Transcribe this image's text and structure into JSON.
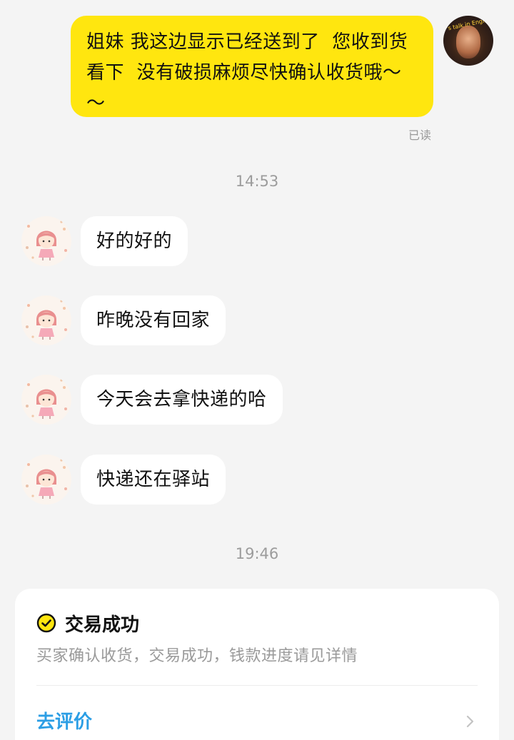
{
  "outgoing_message": {
    "text": "姐妹 我这边显示已经送到了  您收到货看下  没有破损麻烦尽快确认收货哦～～",
    "read_status": "已读",
    "avatar_caption": "'s talk in Engli"
  },
  "timestamps": {
    "first": "14:53",
    "second": "19:46"
  },
  "incoming_messages": [
    {
      "text": "好的好的"
    },
    {
      "text": "昨晚没有回家"
    },
    {
      "text": "今天会去拿快递的哈"
    },
    {
      "text": "快递还在驿站"
    }
  ],
  "order_card": {
    "status_title": "交易成功",
    "description": "买家确认收货，交易成功，钱款进度请见详情",
    "action_label": "去评价",
    "accent_color": "#2b9ee5",
    "status_icon_color": "#ffe60f"
  },
  "colors": {
    "outgoing_bubble": "#ffe60f",
    "incoming_bubble": "#ffffff",
    "background": "#f4f4f4"
  },
  "icons": {
    "status": "check-circle-icon",
    "action": "chevron-right-icon"
  }
}
